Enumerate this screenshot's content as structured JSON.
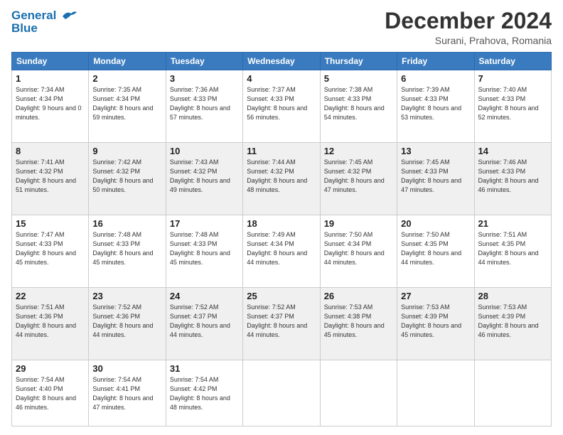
{
  "header": {
    "logo_line1": "General",
    "logo_line2": "Blue",
    "month": "December 2024",
    "location": "Surani, Prahova, Romania"
  },
  "weekdays": [
    "Sunday",
    "Monday",
    "Tuesday",
    "Wednesday",
    "Thursday",
    "Friday",
    "Saturday"
  ],
  "weeks": [
    [
      {
        "day": 1,
        "sunrise": "7:34 AM",
        "sunset": "4:34 PM",
        "daylight": "9 hours and 0 minutes."
      },
      {
        "day": 2,
        "sunrise": "7:35 AM",
        "sunset": "4:34 PM",
        "daylight": "8 hours and 59 minutes."
      },
      {
        "day": 3,
        "sunrise": "7:36 AM",
        "sunset": "4:33 PM",
        "daylight": "8 hours and 57 minutes."
      },
      {
        "day": 4,
        "sunrise": "7:37 AM",
        "sunset": "4:33 PM",
        "daylight": "8 hours and 56 minutes."
      },
      {
        "day": 5,
        "sunrise": "7:38 AM",
        "sunset": "4:33 PM",
        "daylight": "8 hours and 54 minutes."
      },
      {
        "day": 6,
        "sunrise": "7:39 AM",
        "sunset": "4:33 PM",
        "daylight": "8 hours and 53 minutes."
      },
      {
        "day": 7,
        "sunrise": "7:40 AM",
        "sunset": "4:33 PM",
        "daylight": "8 hours and 52 minutes."
      }
    ],
    [
      {
        "day": 8,
        "sunrise": "7:41 AM",
        "sunset": "4:32 PM",
        "daylight": "8 hours and 51 minutes."
      },
      {
        "day": 9,
        "sunrise": "7:42 AM",
        "sunset": "4:32 PM",
        "daylight": "8 hours and 50 minutes."
      },
      {
        "day": 10,
        "sunrise": "7:43 AM",
        "sunset": "4:32 PM",
        "daylight": "8 hours and 49 minutes."
      },
      {
        "day": 11,
        "sunrise": "7:44 AM",
        "sunset": "4:32 PM",
        "daylight": "8 hours and 48 minutes."
      },
      {
        "day": 12,
        "sunrise": "7:45 AM",
        "sunset": "4:32 PM",
        "daylight": "8 hours and 47 minutes."
      },
      {
        "day": 13,
        "sunrise": "7:45 AM",
        "sunset": "4:33 PM",
        "daylight": "8 hours and 47 minutes."
      },
      {
        "day": 14,
        "sunrise": "7:46 AM",
        "sunset": "4:33 PM",
        "daylight": "8 hours and 46 minutes."
      }
    ],
    [
      {
        "day": 15,
        "sunrise": "7:47 AM",
        "sunset": "4:33 PM",
        "daylight": "8 hours and 45 minutes."
      },
      {
        "day": 16,
        "sunrise": "7:48 AM",
        "sunset": "4:33 PM",
        "daylight": "8 hours and 45 minutes."
      },
      {
        "day": 17,
        "sunrise": "7:48 AM",
        "sunset": "4:33 PM",
        "daylight": "8 hours and 45 minutes."
      },
      {
        "day": 18,
        "sunrise": "7:49 AM",
        "sunset": "4:34 PM",
        "daylight": "8 hours and 44 minutes."
      },
      {
        "day": 19,
        "sunrise": "7:50 AM",
        "sunset": "4:34 PM",
        "daylight": "8 hours and 44 minutes."
      },
      {
        "day": 20,
        "sunrise": "7:50 AM",
        "sunset": "4:35 PM",
        "daylight": "8 hours and 44 minutes."
      },
      {
        "day": 21,
        "sunrise": "7:51 AM",
        "sunset": "4:35 PM",
        "daylight": "8 hours and 44 minutes."
      }
    ],
    [
      {
        "day": 22,
        "sunrise": "7:51 AM",
        "sunset": "4:36 PM",
        "daylight": "8 hours and 44 minutes."
      },
      {
        "day": 23,
        "sunrise": "7:52 AM",
        "sunset": "4:36 PM",
        "daylight": "8 hours and 44 minutes."
      },
      {
        "day": 24,
        "sunrise": "7:52 AM",
        "sunset": "4:37 PM",
        "daylight": "8 hours and 44 minutes."
      },
      {
        "day": 25,
        "sunrise": "7:52 AM",
        "sunset": "4:37 PM",
        "daylight": "8 hours and 44 minutes."
      },
      {
        "day": 26,
        "sunrise": "7:53 AM",
        "sunset": "4:38 PM",
        "daylight": "8 hours and 45 minutes."
      },
      {
        "day": 27,
        "sunrise": "7:53 AM",
        "sunset": "4:39 PM",
        "daylight": "8 hours and 45 minutes."
      },
      {
        "day": 28,
        "sunrise": "7:53 AM",
        "sunset": "4:39 PM",
        "daylight": "8 hours and 46 minutes."
      }
    ],
    [
      {
        "day": 29,
        "sunrise": "7:54 AM",
        "sunset": "4:40 PM",
        "daylight": "8 hours and 46 minutes."
      },
      {
        "day": 30,
        "sunrise": "7:54 AM",
        "sunset": "4:41 PM",
        "daylight": "8 hours and 47 minutes."
      },
      {
        "day": 31,
        "sunrise": "7:54 AM",
        "sunset": "4:42 PM",
        "daylight": "8 hours and 48 minutes."
      },
      null,
      null,
      null,
      null
    ]
  ]
}
